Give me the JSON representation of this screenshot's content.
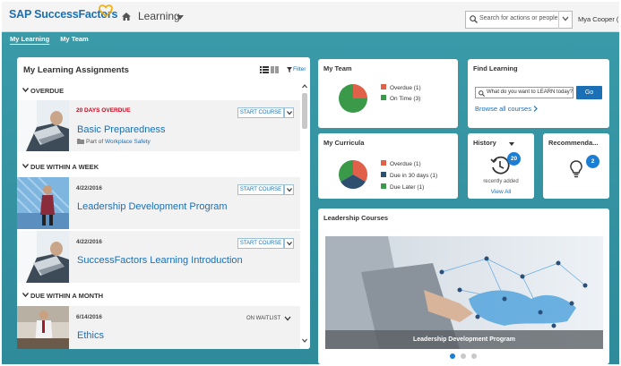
{
  "app": {
    "logo": "SAP SuccessFactors",
    "module": "Learning",
    "search_placeholder": "Search for actions or people",
    "user": "Mya Cooper (",
    "brand_color": "#1a6fb5",
    "band_color": "#3a9aa8"
  },
  "subnav": {
    "items": [
      "My Learning",
      "My Team"
    ]
  },
  "assignments": {
    "title": "My Learning Assignments",
    "filter_label": "Filter",
    "sections": {
      "overdue": "OVERDUE",
      "week": "DUE WITHIN A WEEK",
      "month": "DUE WITHIN A MONTH"
    },
    "items": [
      {
        "date": "20 DAYS OVERDUE",
        "title": "Basic Preparedness",
        "part_prefix": "Part of",
        "part_link": "Workplace Safety",
        "action": "START COURSE"
      },
      {
        "date": "4/22/2016",
        "title": "Leadership Development Program",
        "action": "START COURSE"
      },
      {
        "date": "4/22/2016",
        "title": "SuccessFactors Learning Introduction",
        "action": "START COURSE"
      },
      {
        "date": "6/14/2016",
        "title": "Ethics",
        "action": "ON WAITLIST"
      }
    ]
  },
  "my_team": {
    "title": "My Team",
    "legend": [
      "Overdue (1)",
      "On Time (3)"
    ],
    "colors": [
      "#e0604a",
      "#3a9a4a"
    ],
    "values": [
      1,
      3
    ]
  },
  "my_curricula": {
    "title": "My Curricula",
    "legend": [
      "Overdue (1)",
      "Due in 30 days (1)",
      "Due Later (1)"
    ],
    "colors": [
      "#e0604a",
      "#2f4f6f",
      "#3a9a4a"
    ],
    "values": [
      1,
      1,
      1
    ]
  },
  "find_learning": {
    "title": "Find Learning",
    "placeholder": "What do you want to LEARN today?",
    "go": "Go",
    "browse": "Browse all courses"
  },
  "history": {
    "title": "History",
    "badge": "20",
    "subtitle": "recently added",
    "link": "View All"
  },
  "recommendations": {
    "title": "Recommenda...",
    "badge": "2"
  },
  "leadership": {
    "title": "Leadership Courses",
    "caption": "Leadership Development Program",
    "slides": 3,
    "active_slide": 0
  }
}
